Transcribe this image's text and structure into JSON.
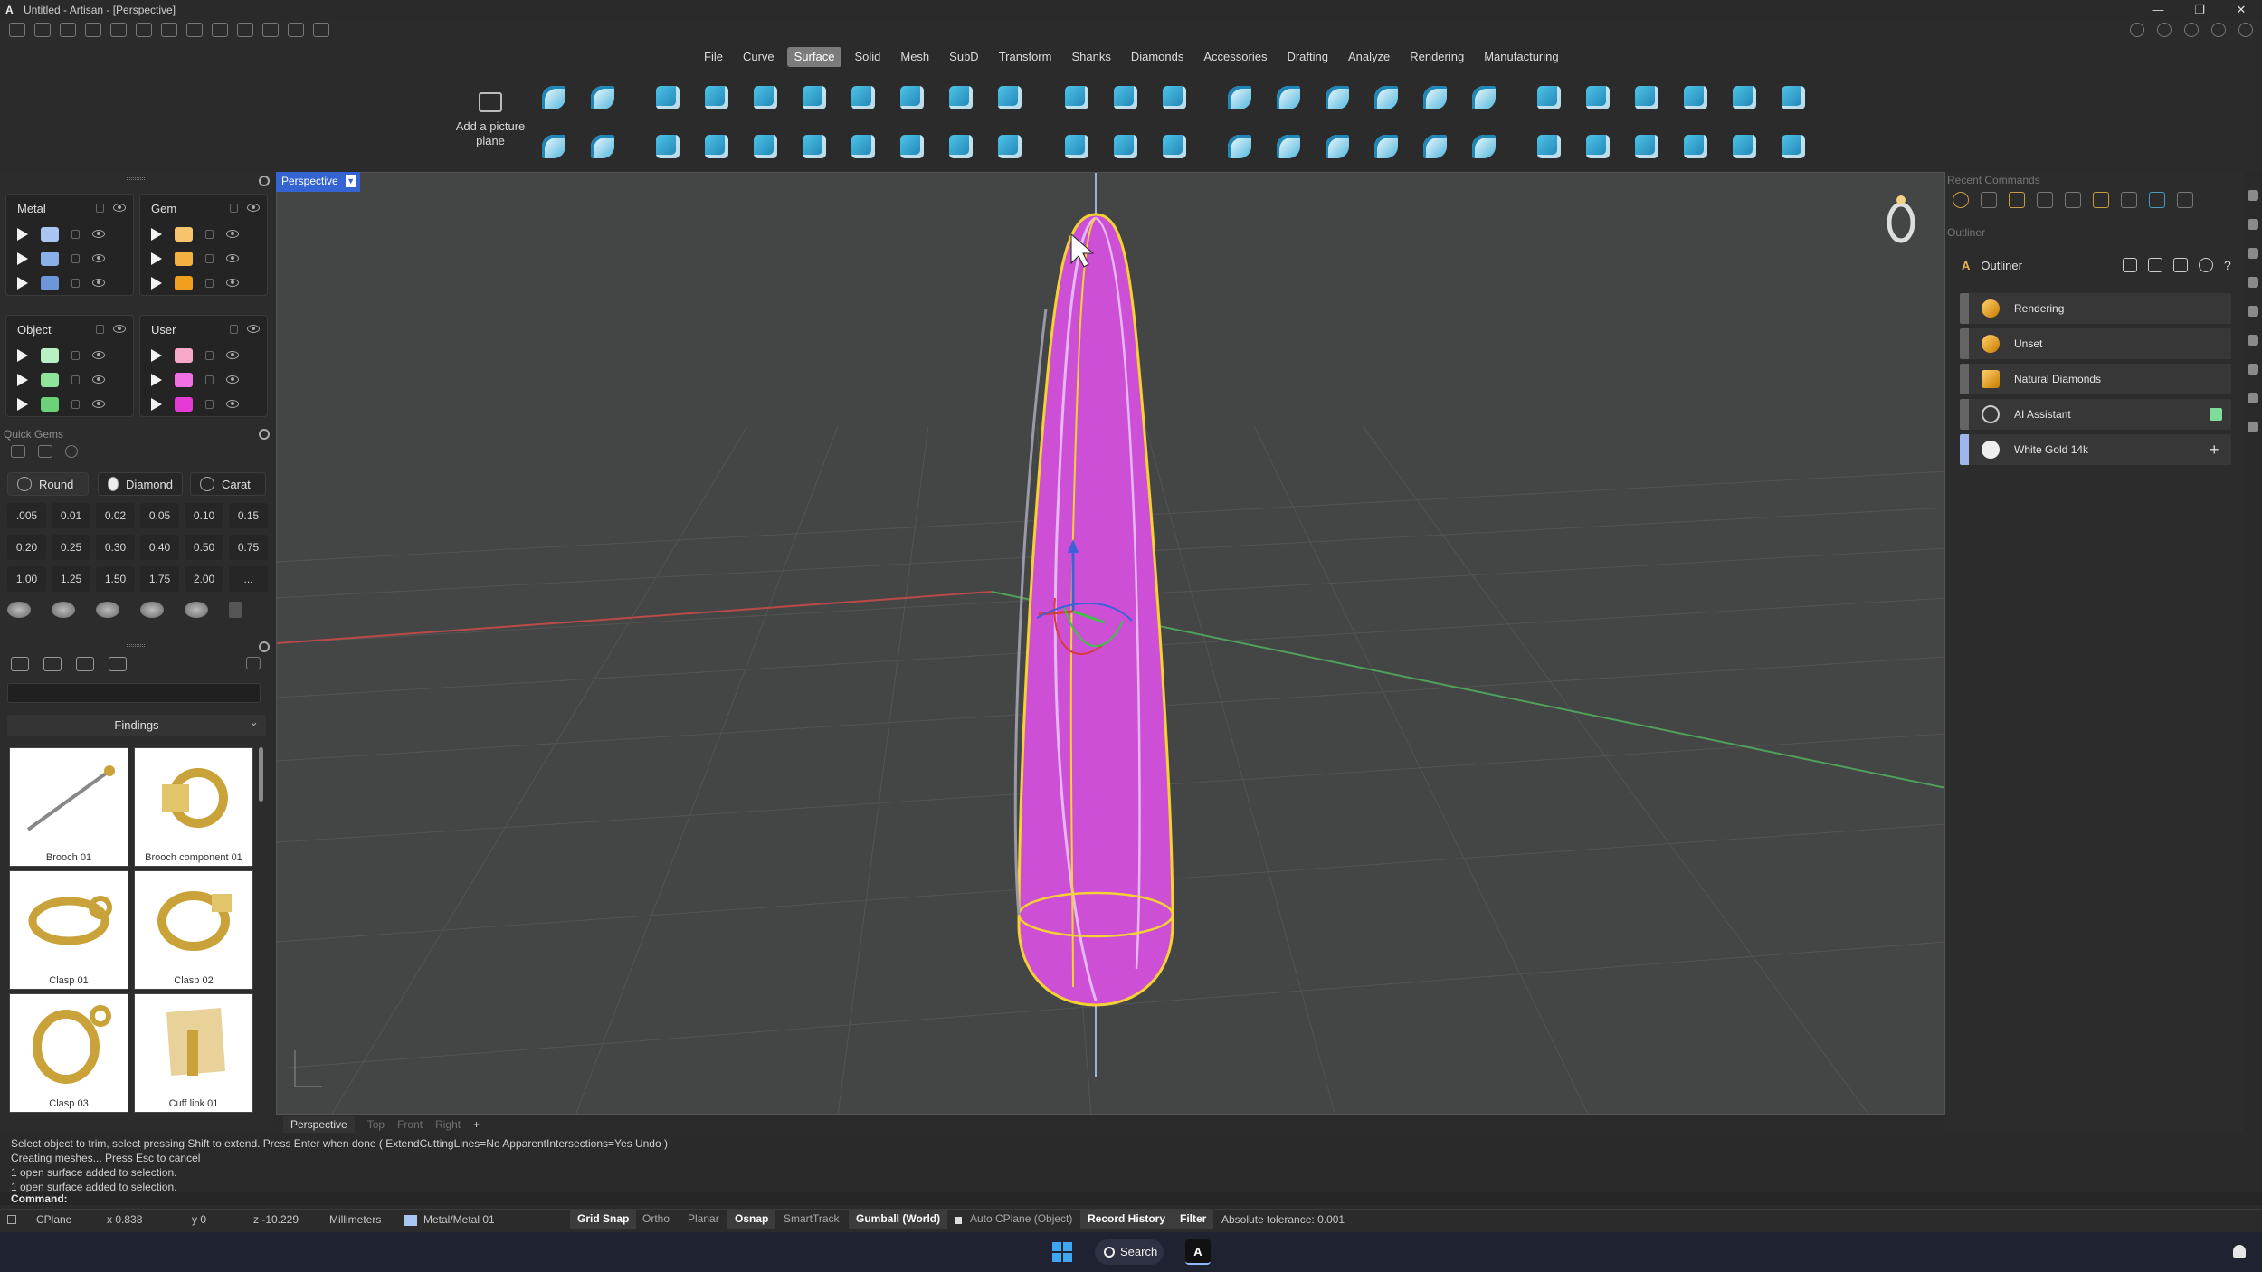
{
  "window": {
    "title": "Untitled - Artisan - [Perspective]",
    "controls": [
      "—",
      "❐",
      "✕"
    ]
  },
  "menu": {
    "tabs": [
      "File",
      "Curve",
      "Surface",
      "Solid",
      "Mesh",
      "SubD",
      "Transform",
      "Shanks",
      "Diamonds",
      "Accessories",
      "Drafting",
      "Analyze",
      "Rendering",
      "Manufacturing"
    ],
    "active": "Surface"
  },
  "toolbar": {
    "add_picture_plane": "Add a picture plane"
  },
  "layers": {
    "metal": {
      "title": "Metal",
      "colors": [
        "#a9c6f2",
        "#8ab0ea",
        "#6e96db"
      ]
    },
    "gem": {
      "title": "Gem",
      "colors": [
        "#f7c36c",
        "#f5b042",
        "#f19f1f"
      ]
    },
    "object": {
      "title": "Object",
      "colors": [
        "#b9f1c2",
        "#8fe39a",
        "#6cd27a"
      ]
    },
    "user": {
      "title": "User",
      "colors": [
        "#f7a8c8",
        "#f06fe4",
        "#e53ad6"
      ]
    }
  },
  "quick_gems": {
    "title": "Quick Gems",
    "shape": "Round",
    "material": "Diamond",
    "unit": "Carat",
    "carats": [
      ".005",
      "0.01",
      "0.02",
      "0.05",
      "0.10",
      "0.15",
      "0.20",
      "0.25",
      "0.30",
      "0.40",
      "0.50",
      "0.75",
      "1.00",
      "1.25",
      "1.50",
      "1.75",
      "2.00",
      "..."
    ]
  },
  "library": {
    "search_placeholder": "",
    "category": "Findings",
    "items": [
      "Brooch 01",
      "Brooch component 01",
      "Clasp 01",
      "Clasp 02",
      "Clasp 03",
      "Cuff link 01"
    ]
  },
  "viewport": {
    "name": "Perspective",
    "tabs": [
      "Perspective",
      "Top",
      "Front",
      "Right",
      "+"
    ],
    "active_tab": "Perspective",
    "object_color": "#cc4fd6",
    "outline_color": "#f5d233"
  },
  "right": {
    "recent_commands": "Recent Commands",
    "outliner_section": "Outliner",
    "outliner_title": "Outliner",
    "rows": [
      {
        "label": "Rendering",
        "icon": "palette-icon"
      },
      {
        "label": "Unset",
        "icon": "leaf-icon"
      },
      {
        "label": "Natural Diamonds",
        "icon": "diamond-icon"
      },
      {
        "label": "AI Assistant",
        "icon": "robot-icon"
      },
      {
        "label": "White Gold 14k",
        "icon": "sphere-icon"
      }
    ]
  },
  "command": {
    "history": [
      "Select object to trim, select pressing Shift to extend. Press Enter when done ( ExtendCuttingLines=No  ApparentIntersections=Yes  Undo )",
      "Creating meshes... Press Esc to cancel",
      "1 open surface added to selection.",
      "1 open surface added to selection."
    ],
    "prompt": "Command:"
  },
  "status": {
    "cplane": "CPlane",
    "x": "x 0.838",
    "y": "y 0",
    "z": "z -10.229",
    "units": "Millimeters",
    "layer": "Metal/Metal 01",
    "grid_snap": "Grid Snap",
    "ortho": "Ortho",
    "planar": "Planar",
    "osnap": "Osnap",
    "smarttrack": "SmartTrack",
    "gumball": "Gumball (World)",
    "auto_cplane": "Auto CPlane (Object)",
    "record_history": "Record History",
    "filter": "Filter",
    "tolerance": "Absolute tolerance: 0.001"
  },
  "taskbar": {
    "search": "Search",
    "app_letter": "A"
  }
}
